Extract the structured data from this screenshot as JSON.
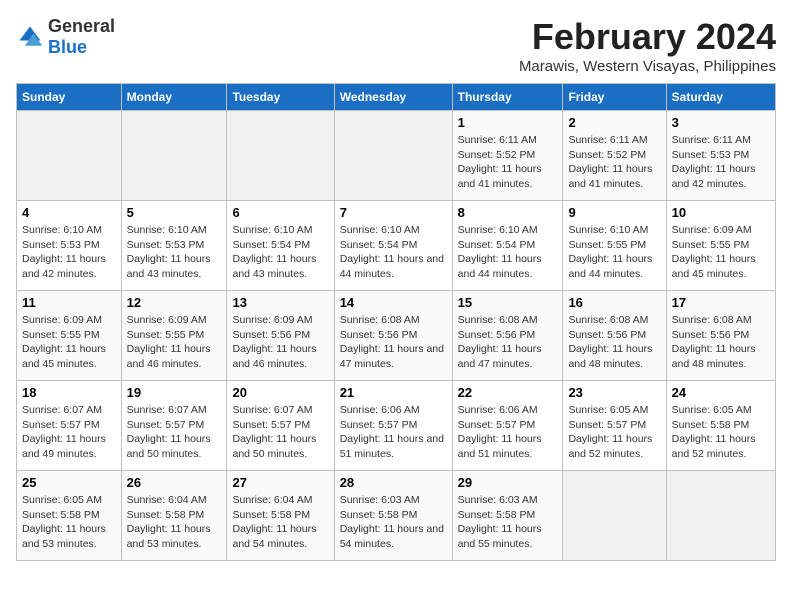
{
  "header": {
    "logo_general": "General",
    "logo_blue": "Blue",
    "month_title": "February 2024",
    "location": "Marawis, Western Visayas, Philippines"
  },
  "days_of_week": [
    "Sunday",
    "Monday",
    "Tuesday",
    "Wednesday",
    "Thursday",
    "Friday",
    "Saturday"
  ],
  "weeks": [
    [
      {
        "day": "",
        "info": ""
      },
      {
        "day": "",
        "info": ""
      },
      {
        "day": "",
        "info": ""
      },
      {
        "day": "",
        "info": ""
      },
      {
        "day": "1",
        "info": "Sunrise: 6:11 AM\nSunset: 5:52 PM\nDaylight: 11 hours and 41 minutes."
      },
      {
        "day": "2",
        "info": "Sunrise: 6:11 AM\nSunset: 5:52 PM\nDaylight: 11 hours and 41 minutes."
      },
      {
        "day": "3",
        "info": "Sunrise: 6:11 AM\nSunset: 5:53 PM\nDaylight: 11 hours and 42 minutes."
      }
    ],
    [
      {
        "day": "4",
        "info": "Sunrise: 6:10 AM\nSunset: 5:53 PM\nDaylight: 11 hours and 42 minutes."
      },
      {
        "day": "5",
        "info": "Sunrise: 6:10 AM\nSunset: 5:53 PM\nDaylight: 11 hours and 43 minutes."
      },
      {
        "day": "6",
        "info": "Sunrise: 6:10 AM\nSunset: 5:54 PM\nDaylight: 11 hours and 43 minutes."
      },
      {
        "day": "7",
        "info": "Sunrise: 6:10 AM\nSunset: 5:54 PM\nDaylight: 11 hours and 44 minutes."
      },
      {
        "day": "8",
        "info": "Sunrise: 6:10 AM\nSunset: 5:54 PM\nDaylight: 11 hours and 44 minutes."
      },
      {
        "day": "9",
        "info": "Sunrise: 6:10 AM\nSunset: 5:55 PM\nDaylight: 11 hours and 44 minutes."
      },
      {
        "day": "10",
        "info": "Sunrise: 6:09 AM\nSunset: 5:55 PM\nDaylight: 11 hours and 45 minutes."
      }
    ],
    [
      {
        "day": "11",
        "info": "Sunrise: 6:09 AM\nSunset: 5:55 PM\nDaylight: 11 hours and 45 minutes."
      },
      {
        "day": "12",
        "info": "Sunrise: 6:09 AM\nSunset: 5:55 PM\nDaylight: 11 hours and 46 minutes."
      },
      {
        "day": "13",
        "info": "Sunrise: 6:09 AM\nSunset: 5:56 PM\nDaylight: 11 hours and 46 minutes."
      },
      {
        "day": "14",
        "info": "Sunrise: 6:08 AM\nSunset: 5:56 PM\nDaylight: 11 hours and 47 minutes."
      },
      {
        "day": "15",
        "info": "Sunrise: 6:08 AM\nSunset: 5:56 PM\nDaylight: 11 hours and 47 minutes."
      },
      {
        "day": "16",
        "info": "Sunrise: 6:08 AM\nSunset: 5:56 PM\nDaylight: 11 hours and 48 minutes."
      },
      {
        "day": "17",
        "info": "Sunrise: 6:08 AM\nSunset: 5:56 PM\nDaylight: 11 hours and 48 minutes."
      }
    ],
    [
      {
        "day": "18",
        "info": "Sunrise: 6:07 AM\nSunset: 5:57 PM\nDaylight: 11 hours and 49 minutes."
      },
      {
        "day": "19",
        "info": "Sunrise: 6:07 AM\nSunset: 5:57 PM\nDaylight: 11 hours and 50 minutes."
      },
      {
        "day": "20",
        "info": "Sunrise: 6:07 AM\nSunset: 5:57 PM\nDaylight: 11 hours and 50 minutes."
      },
      {
        "day": "21",
        "info": "Sunrise: 6:06 AM\nSunset: 5:57 PM\nDaylight: 11 hours and 51 minutes."
      },
      {
        "day": "22",
        "info": "Sunrise: 6:06 AM\nSunset: 5:57 PM\nDaylight: 11 hours and 51 minutes."
      },
      {
        "day": "23",
        "info": "Sunrise: 6:05 AM\nSunset: 5:57 PM\nDaylight: 11 hours and 52 minutes."
      },
      {
        "day": "24",
        "info": "Sunrise: 6:05 AM\nSunset: 5:58 PM\nDaylight: 11 hours and 52 minutes."
      }
    ],
    [
      {
        "day": "25",
        "info": "Sunrise: 6:05 AM\nSunset: 5:58 PM\nDaylight: 11 hours and 53 minutes."
      },
      {
        "day": "26",
        "info": "Sunrise: 6:04 AM\nSunset: 5:58 PM\nDaylight: 11 hours and 53 minutes."
      },
      {
        "day": "27",
        "info": "Sunrise: 6:04 AM\nSunset: 5:58 PM\nDaylight: 11 hours and 54 minutes."
      },
      {
        "day": "28",
        "info": "Sunrise: 6:03 AM\nSunset: 5:58 PM\nDaylight: 11 hours and 54 minutes."
      },
      {
        "day": "29",
        "info": "Sunrise: 6:03 AM\nSunset: 5:58 PM\nDaylight: 11 hours and 55 minutes."
      },
      {
        "day": "",
        "info": ""
      },
      {
        "day": "",
        "info": ""
      }
    ]
  ]
}
